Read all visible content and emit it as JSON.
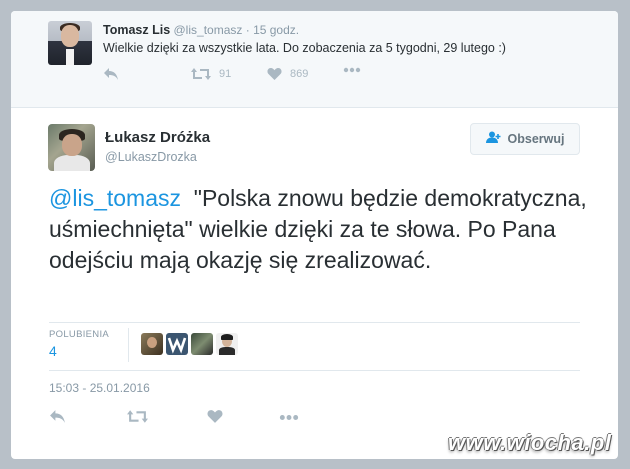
{
  "reply_tweet": {
    "author_name": "Tomasz Lis",
    "author_handle": "@lis_tomasz",
    "separator": "·",
    "time_ago": "15 godz.",
    "text": "Wielkie dzięki za wszystkie lata. Do zobaczenia za 5 tygodni, 29 lutego :)",
    "retweet_count": "91",
    "like_count": "869"
  },
  "main_tweet": {
    "author_name": "Łukasz Dróżka",
    "author_handle": "@LukaszDrozka",
    "follow_label": "Obserwuj",
    "mention": "@lis_tomasz",
    "text_rest": "  \"Polska znowu będzie demokratyczna, uśmiechnięta\" wielkie dzięki za te słowa. Po Pana odejściu mają okazję się zrealizować.",
    "likes_label": "POLUBIENIA",
    "likes_count": "4",
    "timestamp": "15:03 - 25.01.2016"
  },
  "icons": [
    "reply-icon",
    "retweet-icon",
    "heart-icon",
    "more-icon",
    "follow-icon"
  ],
  "colors": {
    "link": "#1b95e0",
    "text": "#292f33",
    "muted": "#8899a6",
    "icon": "#aab8c2"
  },
  "watermark": "www.wiocha.pl"
}
